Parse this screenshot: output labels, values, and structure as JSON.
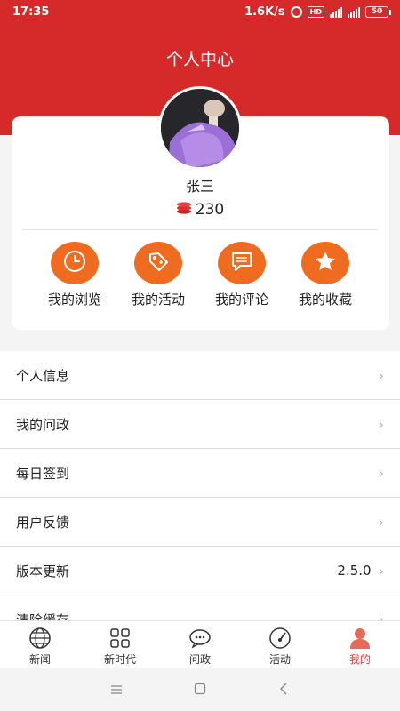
{
  "status_bar": {
    "time": "17:35",
    "net_speed": "1.6K/s",
    "hd_badge": "HD",
    "battery": "50"
  },
  "header": {
    "title": "个人中心"
  },
  "profile": {
    "name": "张三",
    "points": "230"
  },
  "quick_links": [
    {
      "label": "我的浏览",
      "icon": "clock-icon"
    },
    {
      "label": "我的活动",
      "icon": "tag-icon"
    },
    {
      "label": "我的评论",
      "icon": "comment-icon"
    },
    {
      "label": "我的收藏",
      "icon": "star-icon"
    }
  ],
  "menu": [
    {
      "label": "个人信息",
      "value": ""
    },
    {
      "label": "我的问政",
      "value": ""
    },
    {
      "label": "每日签到",
      "value": ""
    },
    {
      "label": "用户反馈",
      "value": ""
    },
    {
      "label": "版本更新",
      "value": "2.5.0"
    },
    {
      "label": "清除缓存",
      "value": ""
    }
  ],
  "tab_bar": [
    {
      "label": "新闻",
      "icon": "globe-icon",
      "active": false
    },
    {
      "label": "新时代",
      "icon": "grid-icon",
      "active": false
    },
    {
      "label": "问政",
      "icon": "chat-bubble-icon",
      "active": false
    },
    {
      "label": "活动",
      "icon": "gauge-icon",
      "active": false
    },
    {
      "label": "我的",
      "icon": "person-icon",
      "active": true
    }
  ],
  "colors": {
    "header_red": "#d62a2a",
    "accent_orange": "#ef6b1f",
    "active_tab": "#e03a3a"
  }
}
